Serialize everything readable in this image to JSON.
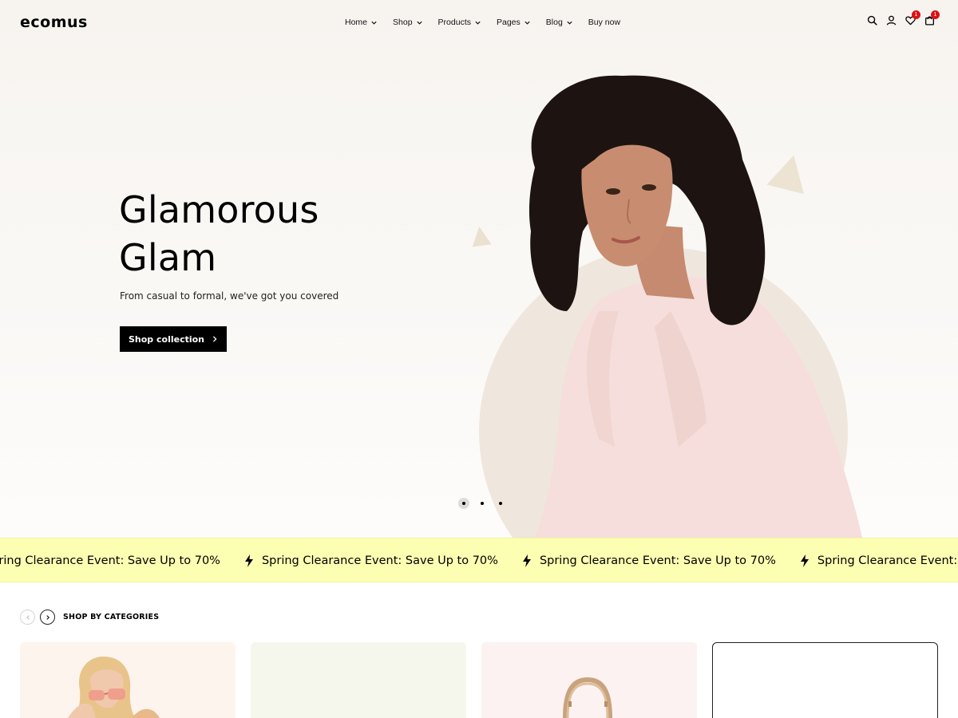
{
  "header": {
    "logo": "ecomus",
    "nav": [
      {
        "label": "Home",
        "has_dropdown": true
      },
      {
        "label": "Shop",
        "has_dropdown": true
      },
      {
        "label": "Products",
        "has_dropdown": true
      },
      {
        "label": "Pages",
        "has_dropdown": true
      },
      {
        "label": "Blog",
        "has_dropdown": true
      },
      {
        "label": "Buy now",
        "has_dropdown": false
      }
    ],
    "icons": [
      "search-icon",
      "user-icon",
      "heart-icon",
      "cart-icon"
    ],
    "wishlist_count": "1",
    "cart_count": "1"
  },
  "hero": {
    "title": "Glamorous\nGlam",
    "subtitle": "From casual to formal, we've got you covered",
    "button_label": "Shop collection",
    "slide_count": 3,
    "active_slide": 1
  },
  "marquee": {
    "text": "Spring Clearance Event: Save Up to 70%",
    "icon": "lightning-icon",
    "background": "#fcffb2"
  },
  "categories": {
    "title": "SHOP BY CATEGORIES",
    "cards": [
      "sunglasses",
      "blank",
      "bag",
      "blank"
    ]
  },
  "colors": {
    "accent": "#000000",
    "badge": "#db1215",
    "hero_bg": "#f7f4f0",
    "hero_circle": "#efe6dd"
  }
}
